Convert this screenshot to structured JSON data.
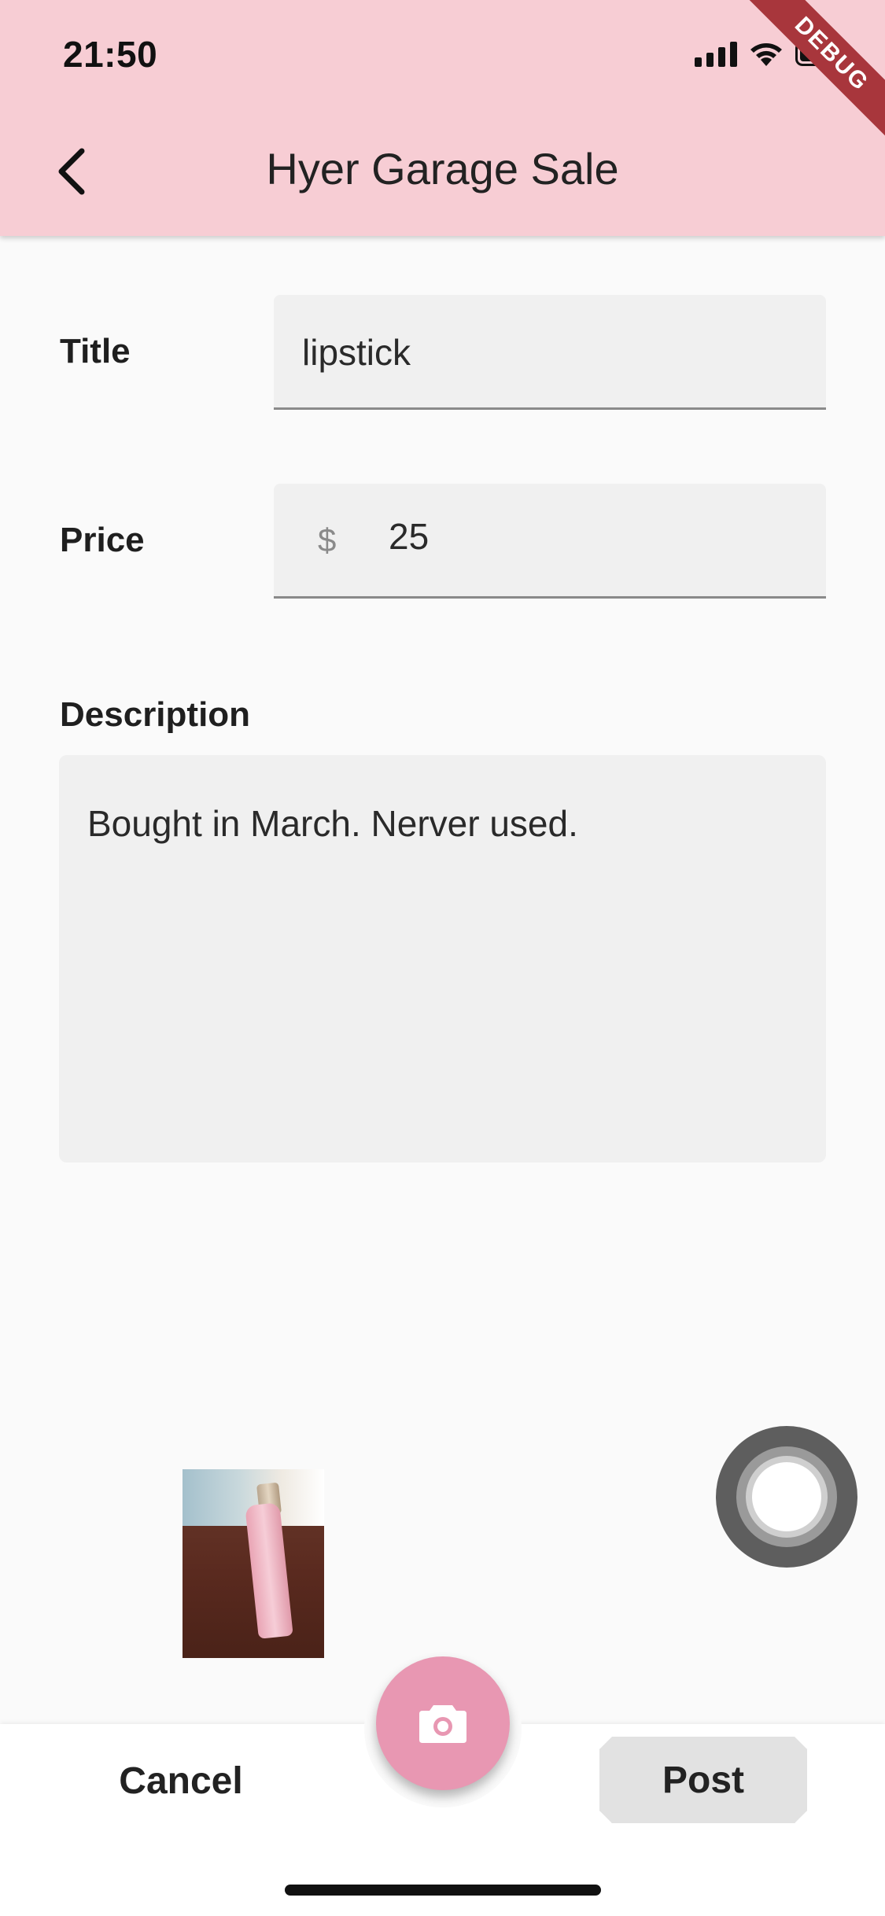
{
  "status_bar": {
    "time": "21:50",
    "debug_banner": "DEBUG"
  },
  "appbar": {
    "title": "Hyer Garage Sale",
    "back_icon": "chevron-left-icon",
    "background_color": "#f7cdd4"
  },
  "form": {
    "title_label": "Title",
    "title_value": "lipstick",
    "price_label": "Price",
    "price_prefix": "$",
    "price_value": "25",
    "description_label": "Description",
    "description_value": "Bought in March. Nerver used."
  },
  "photo": {
    "subject": "lipstick photo thumbnail"
  },
  "bottom_bar": {
    "cancel_label": "Cancel",
    "post_label": "Post",
    "camera_icon": "camera-icon",
    "fab_color": "#e897b2"
  }
}
